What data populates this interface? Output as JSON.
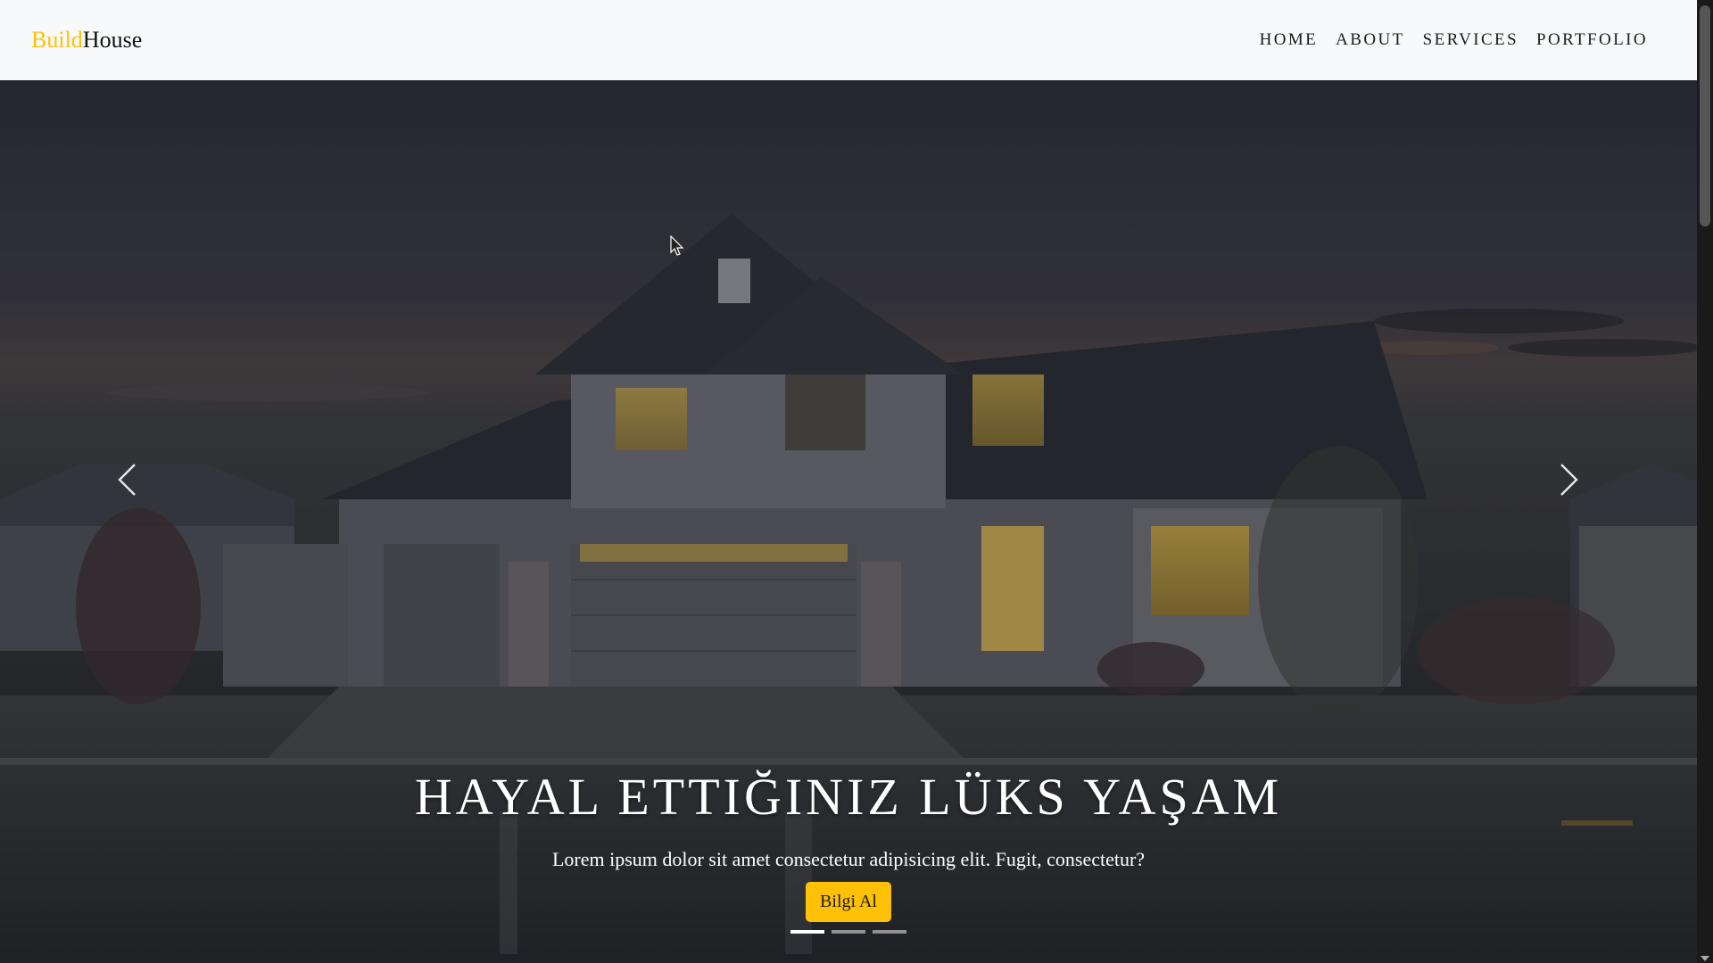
{
  "navbar": {
    "brand_part1": "Build",
    "brand_part2": "House",
    "links": [
      "HOME",
      "ABOUT",
      "SERVICES",
      "PORTFOLIO"
    ]
  },
  "hero": {
    "title": "HAYAL ETTIĞINIZ LÜKS YAŞAM",
    "subtitle": "Lorem ipsum dolor sit amet consectetur adipisicing elit. Fugit, consectetur?",
    "cta_label": "Bilgi Al",
    "background": "house-at-dusk-photo",
    "slides_count": 3,
    "active_slide": 1
  },
  "controls": {
    "prev_icon": "chevron-left-icon",
    "next_icon": "chevron-right-icon"
  },
  "colors": {
    "accent": "#ffc107",
    "navbar_bg": "#f8f9fa",
    "nav_text": "#1b1b1b"
  }
}
